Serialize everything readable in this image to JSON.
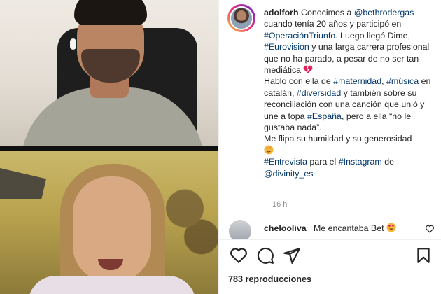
{
  "post": {
    "username": "adolforh",
    "caption_parts": [
      {
        "text": "Conocimos a ",
        "type": "text"
      },
      {
        "text": "@bethrodergas",
        "type": "tag"
      },
      {
        "text": " cuando tenía 20 años y participó en ",
        "type": "text"
      },
      {
        "text": "#OperaciónTriunfo",
        "type": "tag"
      },
      {
        "text": ". Luego llegó Dime, ",
        "type": "text"
      },
      {
        "text": "#Eurovision",
        "type": "tag"
      },
      {
        "text": " y una larga carrera profesional que no ha parado, a pesar de no ser tan mediática ",
        "type": "text"
      }
    ],
    "caption_parts_2": [
      {
        "text": "Hablo con ella de ",
        "type": "text"
      },
      {
        "text": "#maternidad",
        "type": "tag"
      },
      {
        "text": ", ",
        "type": "text"
      },
      {
        "text": "#música",
        "type": "tag"
      },
      {
        "text": " en catalán, ",
        "type": "text"
      },
      {
        "text": "#diversidad",
        "type": "tag"
      },
      {
        "text": " y también sobre su reconciliación con una canción que unió y une a topa ",
        "type": "text"
      },
      {
        "text": "#España",
        "type": "tag"
      },
      {
        "text": ", pero a ella “no le gustaba nada”.",
        "type": "text"
      }
    ],
    "caption_line_3": "Me flipa su humildad y su generosidad",
    "caption_parts_4": [
      {
        "text": "#Entrevista",
        "type": "tag"
      },
      {
        "text": " para el ",
        "type": "text"
      },
      {
        "text": "#Instagram",
        "type": "tag"
      },
      {
        "text": " de ",
        "type": "text"
      },
      {
        "text": "@divinity_es",
        "type": "tag"
      }
    ],
    "time_ago": "16 h"
  },
  "comment": {
    "username": "chelooliva_",
    "text": "Me encantaba Bet"
  },
  "views_label": "783 reproducciones",
  "colors": {
    "tag": "#00376b",
    "text": "#262626",
    "muted": "#8e8e8e"
  },
  "icons": {
    "broken_heart": "broken-heart-emoji",
    "smiling_heart_eyes": "smiling-face-emoji",
    "heart_eyes": "heart-eyes-emoji",
    "like": "heart-icon",
    "comment": "comment-icon",
    "share": "send-icon",
    "save": "bookmark-icon"
  }
}
